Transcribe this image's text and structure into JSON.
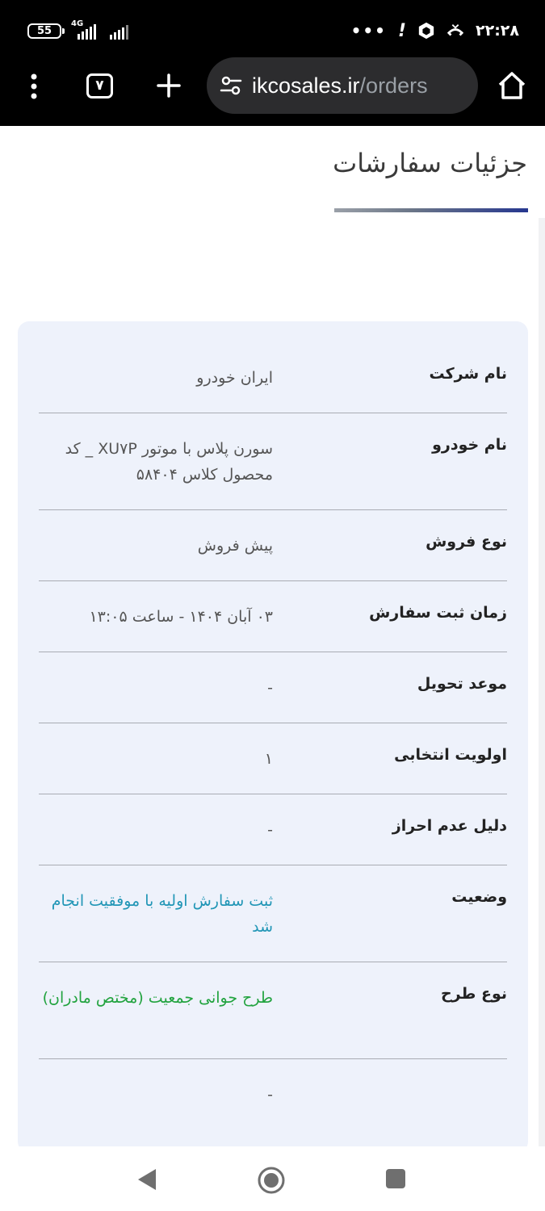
{
  "status_bar": {
    "battery": "55",
    "network": "4G",
    "more": "•••",
    "alert": "!",
    "time": "۲۲:۲۸"
  },
  "browser": {
    "tab_count": "۷",
    "url_host": "ikcosales.ir",
    "url_path": "/orders"
  },
  "page": {
    "title": "جزئیات سفارشات"
  },
  "order_details": [
    {
      "label": "نام شرکت",
      "value": "ایران خودرو"
    },
    {
      "label": "نام خودرو",
      "value": "سورن پلاس با موتور XU۷P _ کد محصول کلاس ۵۸۴۰۴"
    },
    {
      "label": "نوع فروش",
      "value": "پیش فروش"
    },
    {
      "label": "زمان ثبت سفارش",
      "value": "۰۳ آبان ۱۴۰۴ - ساعت ۱۳:۰۵"
    },
    {
      "label": "موعد تحویل",
      "value": "-"
    },
    {
      "label": "اولویت انتخابی",
      "value": "۱"
    },
    {
      "label": "دلیل عدم احراز",
      "value": "-"
    },
    {
      "label": "وضعیت",
      "value": "ثبت سفارش اولیه با موفقیت انجام شد",
      "color": "#2196b6"
    },
    {
      "label": "نوع طرح",
      "value": "طرح جوانی جمعیت (مختص مادران)",
      "color": "#22a33f"
    },
    {
      "label": "",
      "value": "-"
    }
  ],
  "icons": {
    "menu": "three-dots-vertical-icon",
    "tabs": "tab-switcher-icon",
    "new_tab": "plus-icon",
    "site_settings": "tune-icon",
    "home": "home-icon",
    "nav_back": "triangle-back-icon",
    "nav_home": "circle-home-icon",
    "nav_recent": "square-recents-icon"
  }
}
